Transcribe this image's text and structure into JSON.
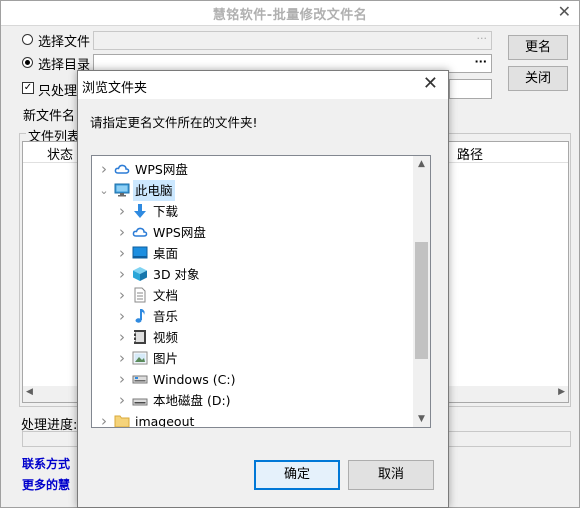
{
  "main": {
    "title": "慧铭软件-批量修改文件名",
    "close_glyph": "✕",
    "select_file_label": "选择文件",
    "select_dir_label": "选择目录",
    "only_process_label": "只处理",
    "ellipsis_disabled": "···",
    "ellipsis": "···",
    "rename_button": "更名",
    "close_button": "关闭",
    "new_name_label": "新文件名",
    "file_list_label": "文件列表",
    "col_status": "状态",
    "col_path": "路径",
    "progress_label": "处理进度:",
    "contact_label": "联系方式",
    "more_label": "更多的慧"
  },
  "dialog": {
    "title": "浏览文件夹",
    "close_glyph": "✕",
    "prompt": "请指定更名文件所在的文件夹!",
    "ok_button": "确定",
    "cancel_button": "取消",
    "tree": [
      {
        "label": "WPS网盘",
        "icon": "cloud-icon",
        "level": 0,
        "chevron": "right"
      },
      {
        "label": "此电脑",
        "icon": "computer-icon",
        "level": 0,
        "chevron": "down",
        "selected": true
      },
      {
        "label": "下载",
        "icon": "download-icon",
        "level": 1,
        "chevron": "right"
      },
      {
        "label": "WPS网盘",
        "icon": "cloud-icon",
        "level": 1,
        "chevron": "right"
      },
      {
        "label": "桌面",
        "icon": "desktop-icon",
        "level": 1,
        "chevron": "right"
      },
      {
        "label": "3D 对象",
        "icon": "cube-icon",
        "level": 1,
        "chevron": "right"
      },
      {
        "label": "文档",
        "icon": "document-icon",
        "level": 1,
        "chevron": "right"
      },
      {
        "label": "音乐",
        "icon": "music-icon",
        "level": 1,
        "chevron": "right"
      },
      {
        "label": "视频",
        "icon": "video-icon",
        "level": 1,
        "chevron": "right"
      },
      {
        "label": "图片",
        "icon": "picture-icon",
        "level": 1,
        "chevron": "right"
      },
      {
        "label": "Windows (C:)",
        "icon": "drive-c-icon",
        "level": 1,
        "chevron": "right"
      },
      {
        "label": "本地磁盘 (D:)",
        "icon": "drive-icon",
        "level": 1,
        "chevron": "right"
      },
      {
        "label": "imageout",
        "icon": "folder-icon",
        "level": 0,
        "chevron": "right"
      }
    ]
  },
  "colors": {
    "accent": "#0078d7",
    "link": "#0000cc",
    "selection": "#cce8ff"
  }
}
